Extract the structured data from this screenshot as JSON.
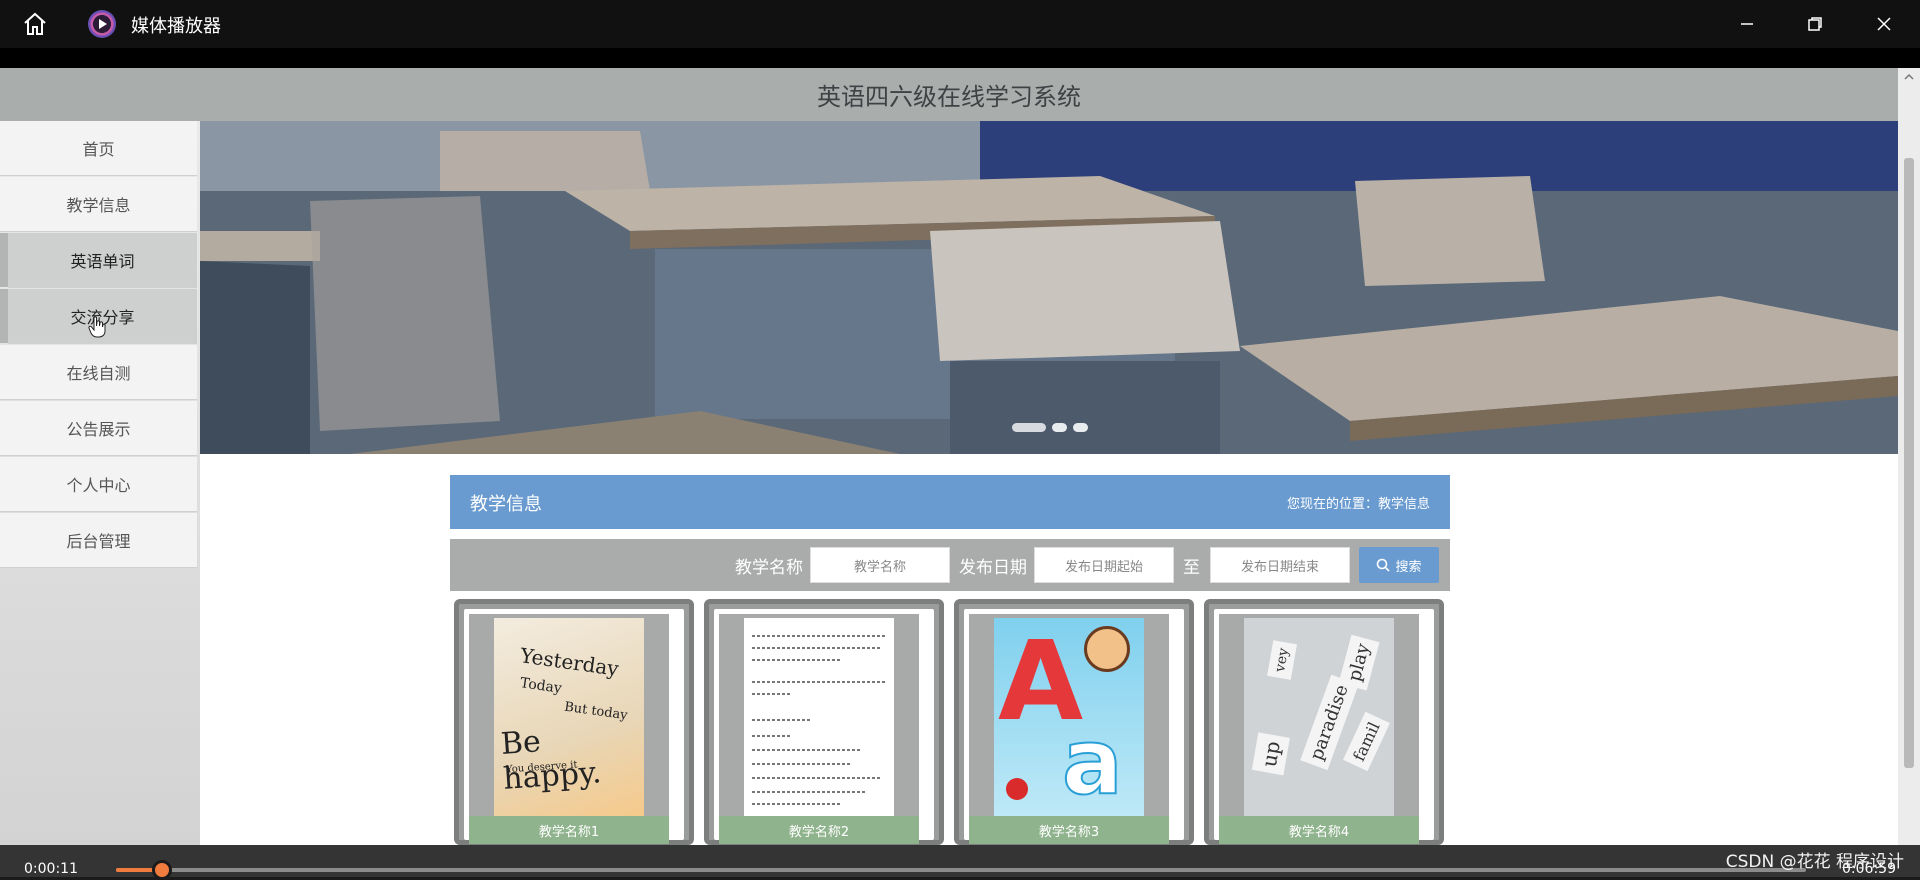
{
  "player": {
    "title": "媒体播放器",
    "icons": {
      "home": "home-icon",
      "app": "play-icon",
      "minimize": "minimize-icon",
      "restore": "restore-icon",
      "close": "close-icon"
    },
    "current_time": "0:00:11",
    "total_time": "0:06:59",
    "progress": 0.027,
    "watermark": "CSDN @花花 程序设计"
  },
  "site": {
    "title": "英语四六级在线学习系统"
  },
  "sidebar": {
    "items": [
      {
        "label": "首页"
      },
      {
        "label": "教学信息"
      },
      {
        "label": "英语单词"
      },
      {
        "label": "交流分享"
      },
      {
        "label": "在线自测"
      },
      {
        "label": "公告展示"
      },
      {
        "label": "个人中心"
      },
      {
        "label": "后台管理"
      }
    ]
  },
  "banner": {
    "slides": 3,
    "active_slide": 0
  },
  "section": {
    "title": "教学信息",
    "breadcrumb": "您现在的位置：教学信息"
  },
  "search": {
    "name_label": "教学名称",
    "name_placeholder": "教学名称",
    "date_label": "发布日期",
    "date_start_placeholder": "发布日期起始",
    "to_label": "至",
    "date_end_placeholder": "发布日期结束",
    "button": "搜索"
  },
  "cards": [
    {
      "label": "教学名称1",
      "image": "yesterday-quote",
      "image_text": [
        "Yesterday",
        "Today",
        "But today",
        "Be happy.",
        "You deserve it"
      ]
    },
    {
      "label": "教学名称2",
      "image": "text-document"
    },
    {
      "label": "教学名称3",
      "image": "alphabet-kid",
      "image_text": [
        "A",
        "a"
      ]
    },
    {
      "label": "教学名称4",
      "image": "word-cards",
      "image_text": [
        "up",
        "paradise",
        "play",
        "famil",
        "vey"
      ]
    }
  ],
  "colors": {
    "accent": "#6a9bd0",
    "card_label": "#8fb38c",
    "progress": "#f07b3f",
    "header": "#a9adac"
  }
}
